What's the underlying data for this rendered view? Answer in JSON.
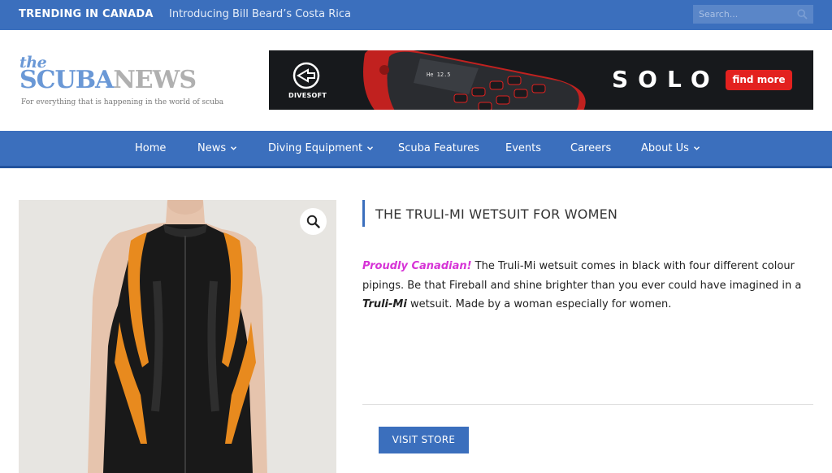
{
  "topbar": {
    "trending_label": "TRENDING IN CANADA",
    "headline": "Introducing Bill Beard’s Costa Rica",
    "search_placeholder": "Search..."
  },
  "logo": {
    "the": "the",
    "scuba": "SCUBA",
    "news": "NEWS",
    "tagline": "For everything that is happening in the world of scuba"
  },
  "banner": {
    "brand": "DIVESOFT",
    "product": "SOLO",
    "cta": "find more"
  },
  "nav": {
    "items": [
      {
        "label": "Home",
        "has_dropdown": false
      },
      {
        "label": "News",
        "has_dropdown": true
      },
      {
        "label": "Diving Equipment",
        "has_dropdown": true
      },
      {
        "label": "Scuba Features",
        "has_dropdown": false
      },
      {
        "label": "Events",
        "has_dropdown": false
      },
      {
        "label": "Careers",
        "has_dropdown": false
      },
      {
        "label": "About Us",
        "has_dropdown": true
      }
    ]
  },
  "product": {
    "title": "THE TRULI-MI WETSUIT FOR WOMEN",
    "desc_highlight": "Proudly Canadian!",
    "desc_part1": " The Truli-Mi wetsuit comes in black with four different colour pipings.  Be that Fireball and shine brighter than you ever could have imagined in a ",
    "desc_brand": "Truli-Mi",
    "desc_part2": " wetsuit.  Made by a woman especially for women.",
    "cta": "VISIT STORE"
  },
  "colors": {
    "brand_blue": "#3b6fbd",
    "highlight_pink": "#d633d6",
    "banner_red": "#e3211f",
    "wetsuit_orange": "#e88a1e"
  }
}
